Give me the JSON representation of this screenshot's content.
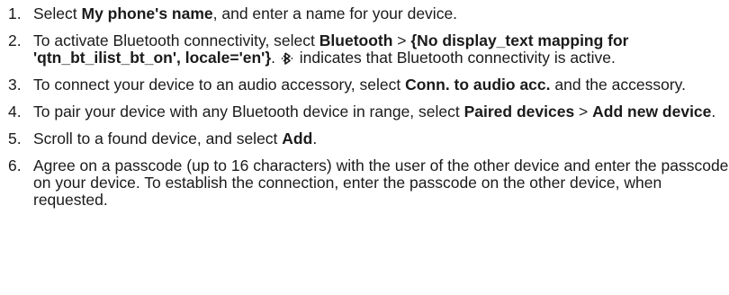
{
  "steps": [
    {
      "number": "1.",
      "pre": "Select ",
      "bold1": "My phone's name",
      "post": ", and enter a name for your device."
    },
    {
      "number": "2.",
      "pre": "To activate Bluetooth connectivity, select ",
      "bold1": "Bluetooth",
      "sep": " > ",
      "bold2": "{No display_text mapping for 'qtn_bt_ilist_bt_on', locale='en'}",
      "mid": ". ",
      "icon": "bluetooth-icon",
      "post": " indicates that Bluetooth connectivity is active."
    },
    {
      "number": "3.",
      "pre": "To connect your device to an audio accessory, select ",
      "bold1": "Conn. to audio acc.",
      "post": " and the accessory."
    },
    {
      "number": "4.",
      "pre": "To pair your device with any Bluetooth device in range, select ",
      "bold1": "Paired devices",
      "sep": " > ",
      "bold2": "Add new device",
      "post": "."
    },
    {
      "number": "5.",
      "pre": "Scroll to a found device, and select ",
      "bold1": "Add",
      "post": "."
    },
    {
      "number": "6.",
      "pre": "Agree on a passcode (up to 16 characters) with the user of the other device and enter the passcode on your device. To establish the connection, enter the passcode on the other device, when requested."
    }
  ]
}
